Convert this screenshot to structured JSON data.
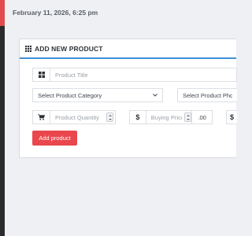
{
  "header": {
    "datetime": "February 11, 2026, 6:25 pm"
  },
  "panel": {
    "title": "ADD NEW PRODUCT",
    "icon": "grid-icon"
  },
  "form": {
    "title_placeholder": "Product Title",
    "category_select": "Select Product Category",
    "photo_select": "Select Product Photo",
    "quantity_placeholder": "Product Quantity",
    "currency_symbol": "$",
    "buying_price_placeholder": "Buying Price",
    "buying_price_decimals": ".00",
    "selling_currency_symbol": "$",
    "submit_label": "Add product"
  },
  "colors": {
    "accent_blue": "#3f8fd8",
    "button_red": "#e9474d",
    "sidebar_dark": "#2b2b2b",
    "sidebar_red": "#e14a4f"
  }
}
